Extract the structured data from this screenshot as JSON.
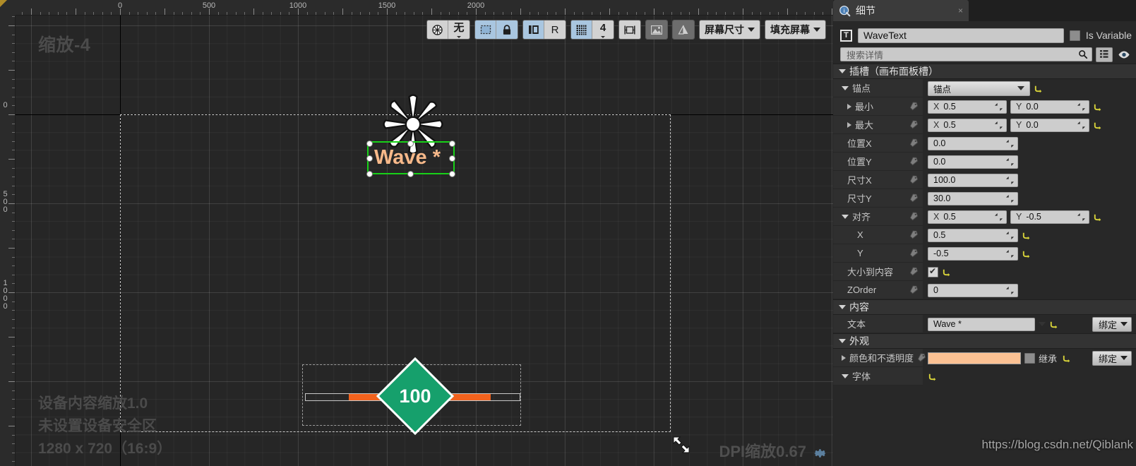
{
  "designer": {
    "zoom_label": "缩放-4",
    "device_content_scale": "设备内容缩放1.0",
    "safe_zone": "未设置设备安全区",
    "resolution": "1280 x 720（16:9）",
    "dpi_scale": "DPI缩放0.67",
    "ruler_h_labels": [
      "0",
      "500",
      "1000",
      "1500",
      "2000"
    ],
    "ruler_v_labels": [
      "0",
      "500",
      "1000"
    ],
    "selected_widget_text": "Wave *",
    "healthbar_value": "100"
  },
  "toolbar": {
    "groups": [
      {
        "buttons": [
          {
            "name": "globe-icon",
            "label": "",
            "icon": "globe",
            "state": "normal"
          },
          {
            "name": "none-dropdown",
            "label": "无",
            "icon": "",
            "state": "normal",
            "caret": true
          }
        ]
      },
      {
        "buttons": [
          {
            "name": "marquee-select",
            "label": "",
            "icon": "marquee",
            "state": "on"
          },
          {
            "name": "lock-icon",
            "label": "",
            "icon": "lock",
            "state": "on"
          }
        ]
      },
      {
        "buttons": [
          {
            "name": "localization-preview",
            "label": "",
            "icon": "panels",
            "state": "on"
          },
          {
            "name": "rtl-toggle",
            "label": "R",
            "icon": "",
            "state": "off"
          }
        ]
      },
      {
        "buttons": [
          {
            "name": "snap-grid-toggle",
            "label": "",
            "icon": "grid",
            "state": "on"
          },
          {
            "name": "grid-size-value",
            "label": "4",
            "icon": "",
            "state": "normal",
            "caret": true
          }
        ]
      },
      {
        "buttons": [
          {
            "name": "snap-to-widget",
            "label": "",
            "icon": "snapwidget",
            "state": "normal"
          }
        ]
      },
      {
        "buttons": [
          {
            "name": "show-image-outlines",
            "label": "",
            "icon": "image",
            "state": "dark"
          }
        ]
      },
      {
        "buttons": [
          {
            "name": "show-dashed-outlines",
            "label": "",
            "icon": "triangle",
            "state": "dark"
          }
        ]
      },
      {
        "buttons": [
          {
            "name": "screen-size-dropdown",
            "label": "屏幕尺寸",
            "icon": "",
            "state": "normal",
            "caret": true
          }
        ]
      },
      {
        "buttons": [
          {
            "name": "fill-screen-dropdown",
            "label": "填充屏幕",
            "icon": "",
            "state": "normal",
            "caret": true
          }
        ]
      }
    ]
  },
  "details": {
    "tab_title": "细节",
    "tab_close": "×",
    "widget_name": "WaveText",
    "is_variable_label": "Is Variable",
    "is_variable_checked": false,
    "search_placeholder": "搜索详情",
    "sections": [
      {
        "name": "slot",
        "title": "插槽（画布面板槽）",
        "rows": [
          {
            "name": "anchors",
            "label": "锚点",
            "type": "combo",
            "value": "锚点",
            "indent": 0,
            "expandable": true,
            "reset": true
          },
          {
            "name": "anchor-min",
            "label": "最小",
            "type": "xy",
            "x_axis": "X",
            "x": "0.5",
            "y_axis": "Y",
            "y": "0.0",
            "indent": 1,
            "expandable": true,
            "pin": true,
            "reset": true
          },
          {
            "name": "anchor-max",
            "label": "最大",
            "type": "xy",
            "x_axis": "X",
            "x": "0.5",
            "y_axis": "Y",
            "y": "0.0",
            "indent": 1,
            "expandable": true,
            "pin": true,
            "reset": true
          },
          {
            "name": "position-x",
            "label": "位置X",
            "type": "single",
            "value": "0.0",
            "indent": 1,
            "pin": true
          },
          {
            "name": "position-y",
            "label": "位置Y",
            "type": "single",
            "value": "0.0",
            "indent": 1,
            "pin": true
          },
          {
            "name": "size-x",
            "label": "尺寸X",
            "type": "single",
            "value": "100.0",
            "indent": 1,
            "pin": true
          },
          {
            "name": "size-y",
            "label": "尺寸Y",
            "type": "single",
            "value": "30.0",
            "indent": 1,
            "pin": true
          },
          {
            "name": "alignment",
            "label": "对齐",
            "type": "xy",
            "x_axis": "X",
            "x": "0.5",
            "y_axis": "Y",
            "y": "-0.5",
            "indent": 0,
            "expandable": true,
            "pin": true,
            "reset": true
          },
          {
            "name": "alignment-x",
            "label": "X",
            "type": "single",
            "value": "0.5",
            "indent": 2,
            "pin": true,
            "reset": true
          },
          {
            "name": "alignment-y",
            "label": "Y",
            "type": "single",
            "value": "-0.5",
            "indent": 2,
            "pin": true,
            "reset": true
          },
          {
            "name": "size-to-content",
            "label": "大小到内容",
            "type": "checkbox",
            "checked": true,
            "indent": 1,
            "pin": true,
            "reset": true
          },
          {
            "name": "zorder",
            "label": "ZOrder",
            "type": "single",
            "value": "0",
            "indent": 1,
            "pin": true
          }
        ]
      },
      {
        "name": "content",
        "title": "内容",
        "rows": [
          {
            "name": "text",
            "label": "文本",
            "type": "text-combo",
            "value": "Wave *",
            "indent": 1,
            "reset": true,
            "bind_label": "绑定"
          }
        ]
      },
      {
        "name": "appearance",
        "title": "外观",
        "rows": [
          {
            "name": "color-and-opacity",
            "label": "颜色和不透明度",
            "type": "color",
            "color": "#fbc193",
            "inherit_label": "继承",
            "inherit_checked": false,
            "indent": 0,
            "expandable": true,
            "pin": true,
            "reset": true,
            "bind_label": "绑定"
          },
          {
            "name": "font",
            "label": "字体",
            "type": "header-row",
            "indent": 0,
            "expandable": true,
            "reset": true
          }
        ]
      }
    ],
    "watermark": "https://blog.csdn.net/Qiblank"
  }
}
